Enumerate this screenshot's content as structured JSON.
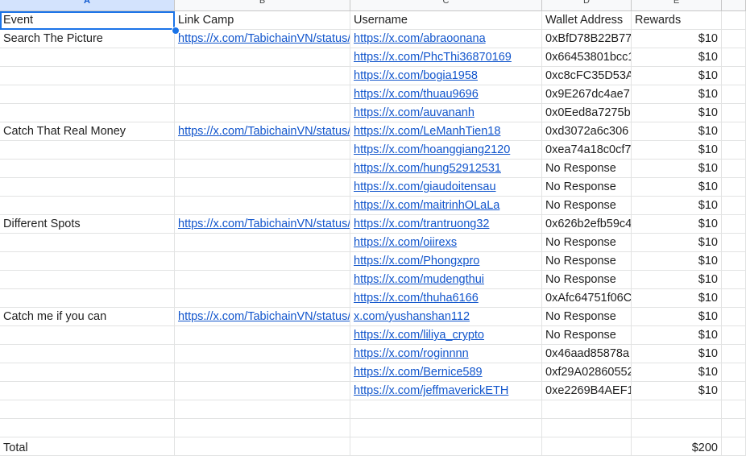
{
  "columns": [
    "A",
    "B",
    "C",
    "D",
    "E"
  ],
  "selected_column": "A",
  "header_row": {
    "event": "Event",
    "link_camp": "Link Camp",
    "username": "Username",
    "wallet": "Wallet Address",
    "rewards": "Rewards"
  },
  "rows": [
    {
      "event": "Search The Picture",
      "link": "https://x.com/TabichainVN/status/",
      "username": "https://x.com/abraoonana",
      "wallet": "0xBfD78B22B77",
      "reward": "$10"
    },
    {
      "event": "",
      "link": "",
      "username": "https://x.com/PhcThi36870169",
      "wallet": "0x66453801bcc1",
      "reward": "$10"
    },
    {
      "event": "",
      "link": "",
      "username": "https://x.com/bogia1958",
      "wallet": "0xc8cFC35D53A",
      "reward": "$10"
    },
    {
      "event": "",
      "link": "",
      "username": "https://x.com/thuau9696",
      "wallet": "0x9E267dc4ae7",
      "reward": "$10"
    },
    {
      "event": "",
      "link": "",
      "username": "https://x.com/auvananh",
      "wallet": "0x0Eed8a7275b",
      "reward": "$10"
    },
    {
      "event": "Catch That Real Money",
      "link": "https://x.com/TabichainVN/status/",
      "username": "https://x.com/LeManhTien18",
      "wallet": "0xd3072a6c306",
      "reward": "$10"
    },
    {
      "event": "",
      "link": "",
      "username": "https://x.com/hoanggiang2120",
      "wallet": "0xea74a18c0cf7",
      "reward": "$10"
    },
    {
      "event": "",
      "link": "",
      "username": "https://x.com/hung52912531",
      "wallet": "No Response",
      "reward": "$10"
    },
    {
      "event": "",
      "link": "",
      "username": "https://x.com/giaudoitensau",
      "wallet": "No Response",
      "reward": "$10"
    },
    {
      "event": "",
      "link": "",
      "username": "https://x.com/maitrinhOLaLa",
      "wallet": "No Response",
      "reward": "$10"
    },
    {
      "event": "Different Spots",
      "link": "https://x.com/TabichainVN/status/",
      "username": "https://x.com/trantruong32",
      "wallet": "0x626b2efb59c4",
      "reward": "$10"
    },
    {
      "event": "",
      "link": "",
      "username": "https://x.com/oiirexs",
      "wallet": "No Response",
      "reward": "$10"
    },
    {
      "event": "",
      "link": "",
      "username": "https://x.com/Phongxpro",
      "wallet": "No Response",
      "reward": "$10"
    },
    {
      "event": "",
      "link": "",
      "username": "https://x.com/mudengthui",
      "wallet": "No Response",
      "reward": "$10"
    },
    {
      "event": "",
      "link": "",
      "username": "https://x.com/thuha6166",
      "wallet": "0xAfc64751f06C",
      "reward": "$10"
    },
    {
      "event": "Catch me if you can",
      "link": "https://x.com/TabichainVN/status/",
      "username": "x.com/yushanshan112",
      "wallet": "No Response",
      "reward": "$10"
    },
    {
      "event": "",
      "link": "",
      "username": "https://x.com/liliya_crypto",
      "wallet": "No Response",
      "reward": "$10"
    },
    {
      "event": "",
      "link": "",
      "username": "https://x.com/roginnnn",
      "wallet": "0x46aad85878a",
      "reward": "$10"
    },
    {
      "event": "",
      "link": "",
      "username": "https://x.com/Bernice589",
      "wallet": "0xf29A02860552",
      "reward": "$10"
    },
    {
      "event": "",
      "link": "",
      "username": "https://x.com/jeffmaverickETH",
      "wallet": "0xe2269B4AEF1",
      "reward": "$10"
    },
    {
      "event": "",
      "link": "",
      "username": "",
      "wallet": "",
      "reward": ""
    },
    {
      "event": "",
      "link": "",
      "username": "",
      "wallet": "",
      "reward": ""
    }
  ],
  "total_row": {
    "label": "Total",
    "reward": "$200"
  },
  "colors": {
    "link": "#1155cc",
    "selection": "#1a73e8",
    "header_bg": "#f8f9fa"
  }
}
